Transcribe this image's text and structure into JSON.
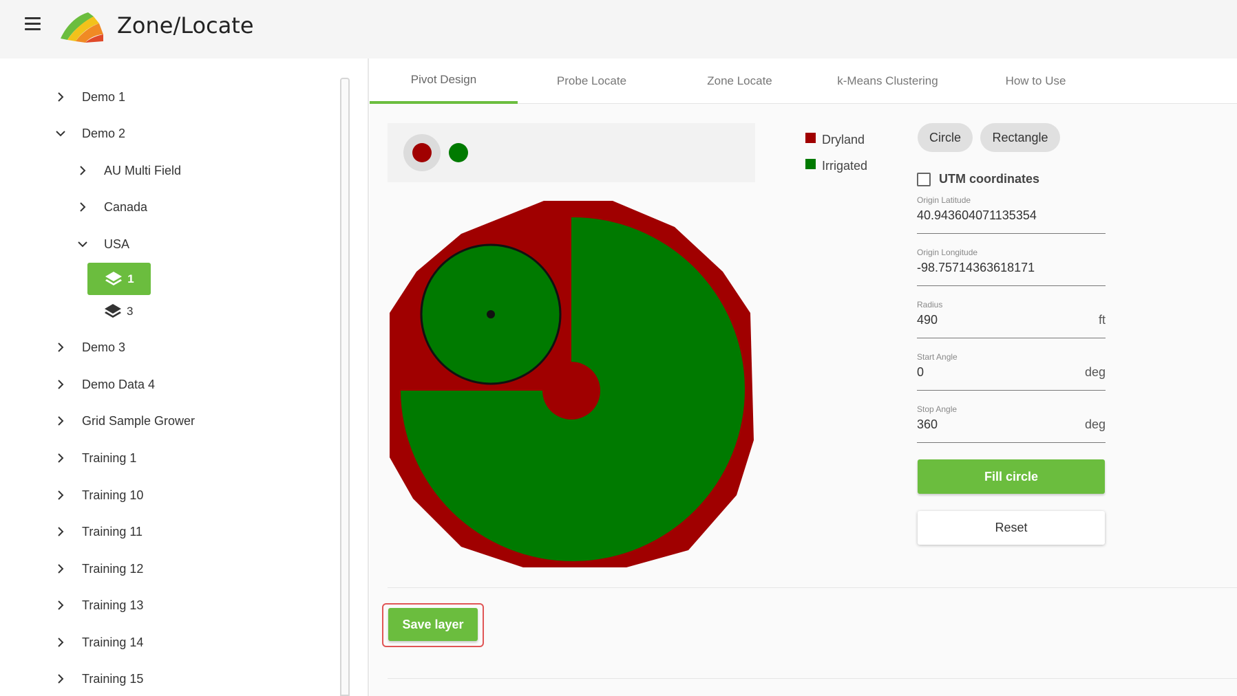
{
  "app": {
    "title": "Zone/Locate",
    "menu_icon": "hamburger-menu-icon",
    "logo_icon": "zone-locate-logo-icon"
  },
  "sidebar": {
    "items": [
      {
        "label": "Demo 1",
        "expanded": false
      },
      {
        "label": "Demo 2",
        "expanded": true
      },
      {
        "label": "AU Multi Field",
        "expanded": false
      },
      {
        "label": "Canada",
        "expanded": false
      },
      {
        "label": "USA",
        "expanded": true
      },
      {
        "label": "Demo 3",
        "expanded": false
      },
      {
        "label": "Demo Data 4",
        "expanded": false
      },
      {
        "label": "Grid Sample Grower",
        "expanded": false
      },
      {
        "label": "Training 1",
        "expanded": false
      },
      {
        "label": "Training 10",
        "expanded": false
      },
      {
        "label": "Training 11",
        "expanded": false
      },
      {
        "label": "Training 12",
        "expanded": false
      },
      {
        "label": "Training 13",
        "expanded": false
      },
      {
        "label": "Training 14",
        "expanded": false
      },
      {
        "label": "Training 15",
        "expanded": false
      }
    ],
    "layers": [
      {
        "label": "1",
        "selected": true,
        "icon": "layers-icon"
      },
      {
        "label": "3",
        "selected": false,
        "icon": "layers-icon"
      }
    ]
  },
  "tabs": [
    {
      "label": "Pivot Design",
      "active": true
    },
    {
      "label": "Probe Locate",
      "active": false
    },
    {
      "label": "Zone Locate",
      "active": false
    },
    {
      "label": "k-Means Clustering",
      "active": false
    },
    {
      "label": "How to Use",
      "active": false
    }
  ],
  "colors": {
    "accent": "#6bbd3e",
    "dryland": "#a00000",
    "irrigated": "#007a00"
  },
  "legend": [
    {
      "label": "Dryland",
      "color": "#a00000"
    },
    {
      "label": "Irrigated",
      "color": "#007a00"
    }
  ],
  "shape_buttons": {
    "circle": "Circle",
    "rectangle": "Rectangle"
  },
  "utm": {
    "label": "UTM coordinates",
    "checked": false
  },
  "fields": {
    "origin_latitude": {
      "label": "Origin Latitude",
      "value": "40.943604071135354",
      "unit": ""
    },
    "origin_longitude": {
      "label": "Origin Longitude",
      "value": "-98.75714363618171",
      "unit": ""
    },
    "radius": {
      "label": "Radius",
      "value": "490",
      "unit": "ft"
    },
    "start_angle": {
      "label": "Start Angle",
      "value": "0",
      "unit": "deg"
    },
    "stop_angle": {
      "label": "Stop Angle",
      "value": "360",
      "unit": "deg"
    }
  },
  "buttons": {
    "fill_circle": "Fill circle",
    "reset": "Reset",
    "save_layer": "Save layer"
  }
}
